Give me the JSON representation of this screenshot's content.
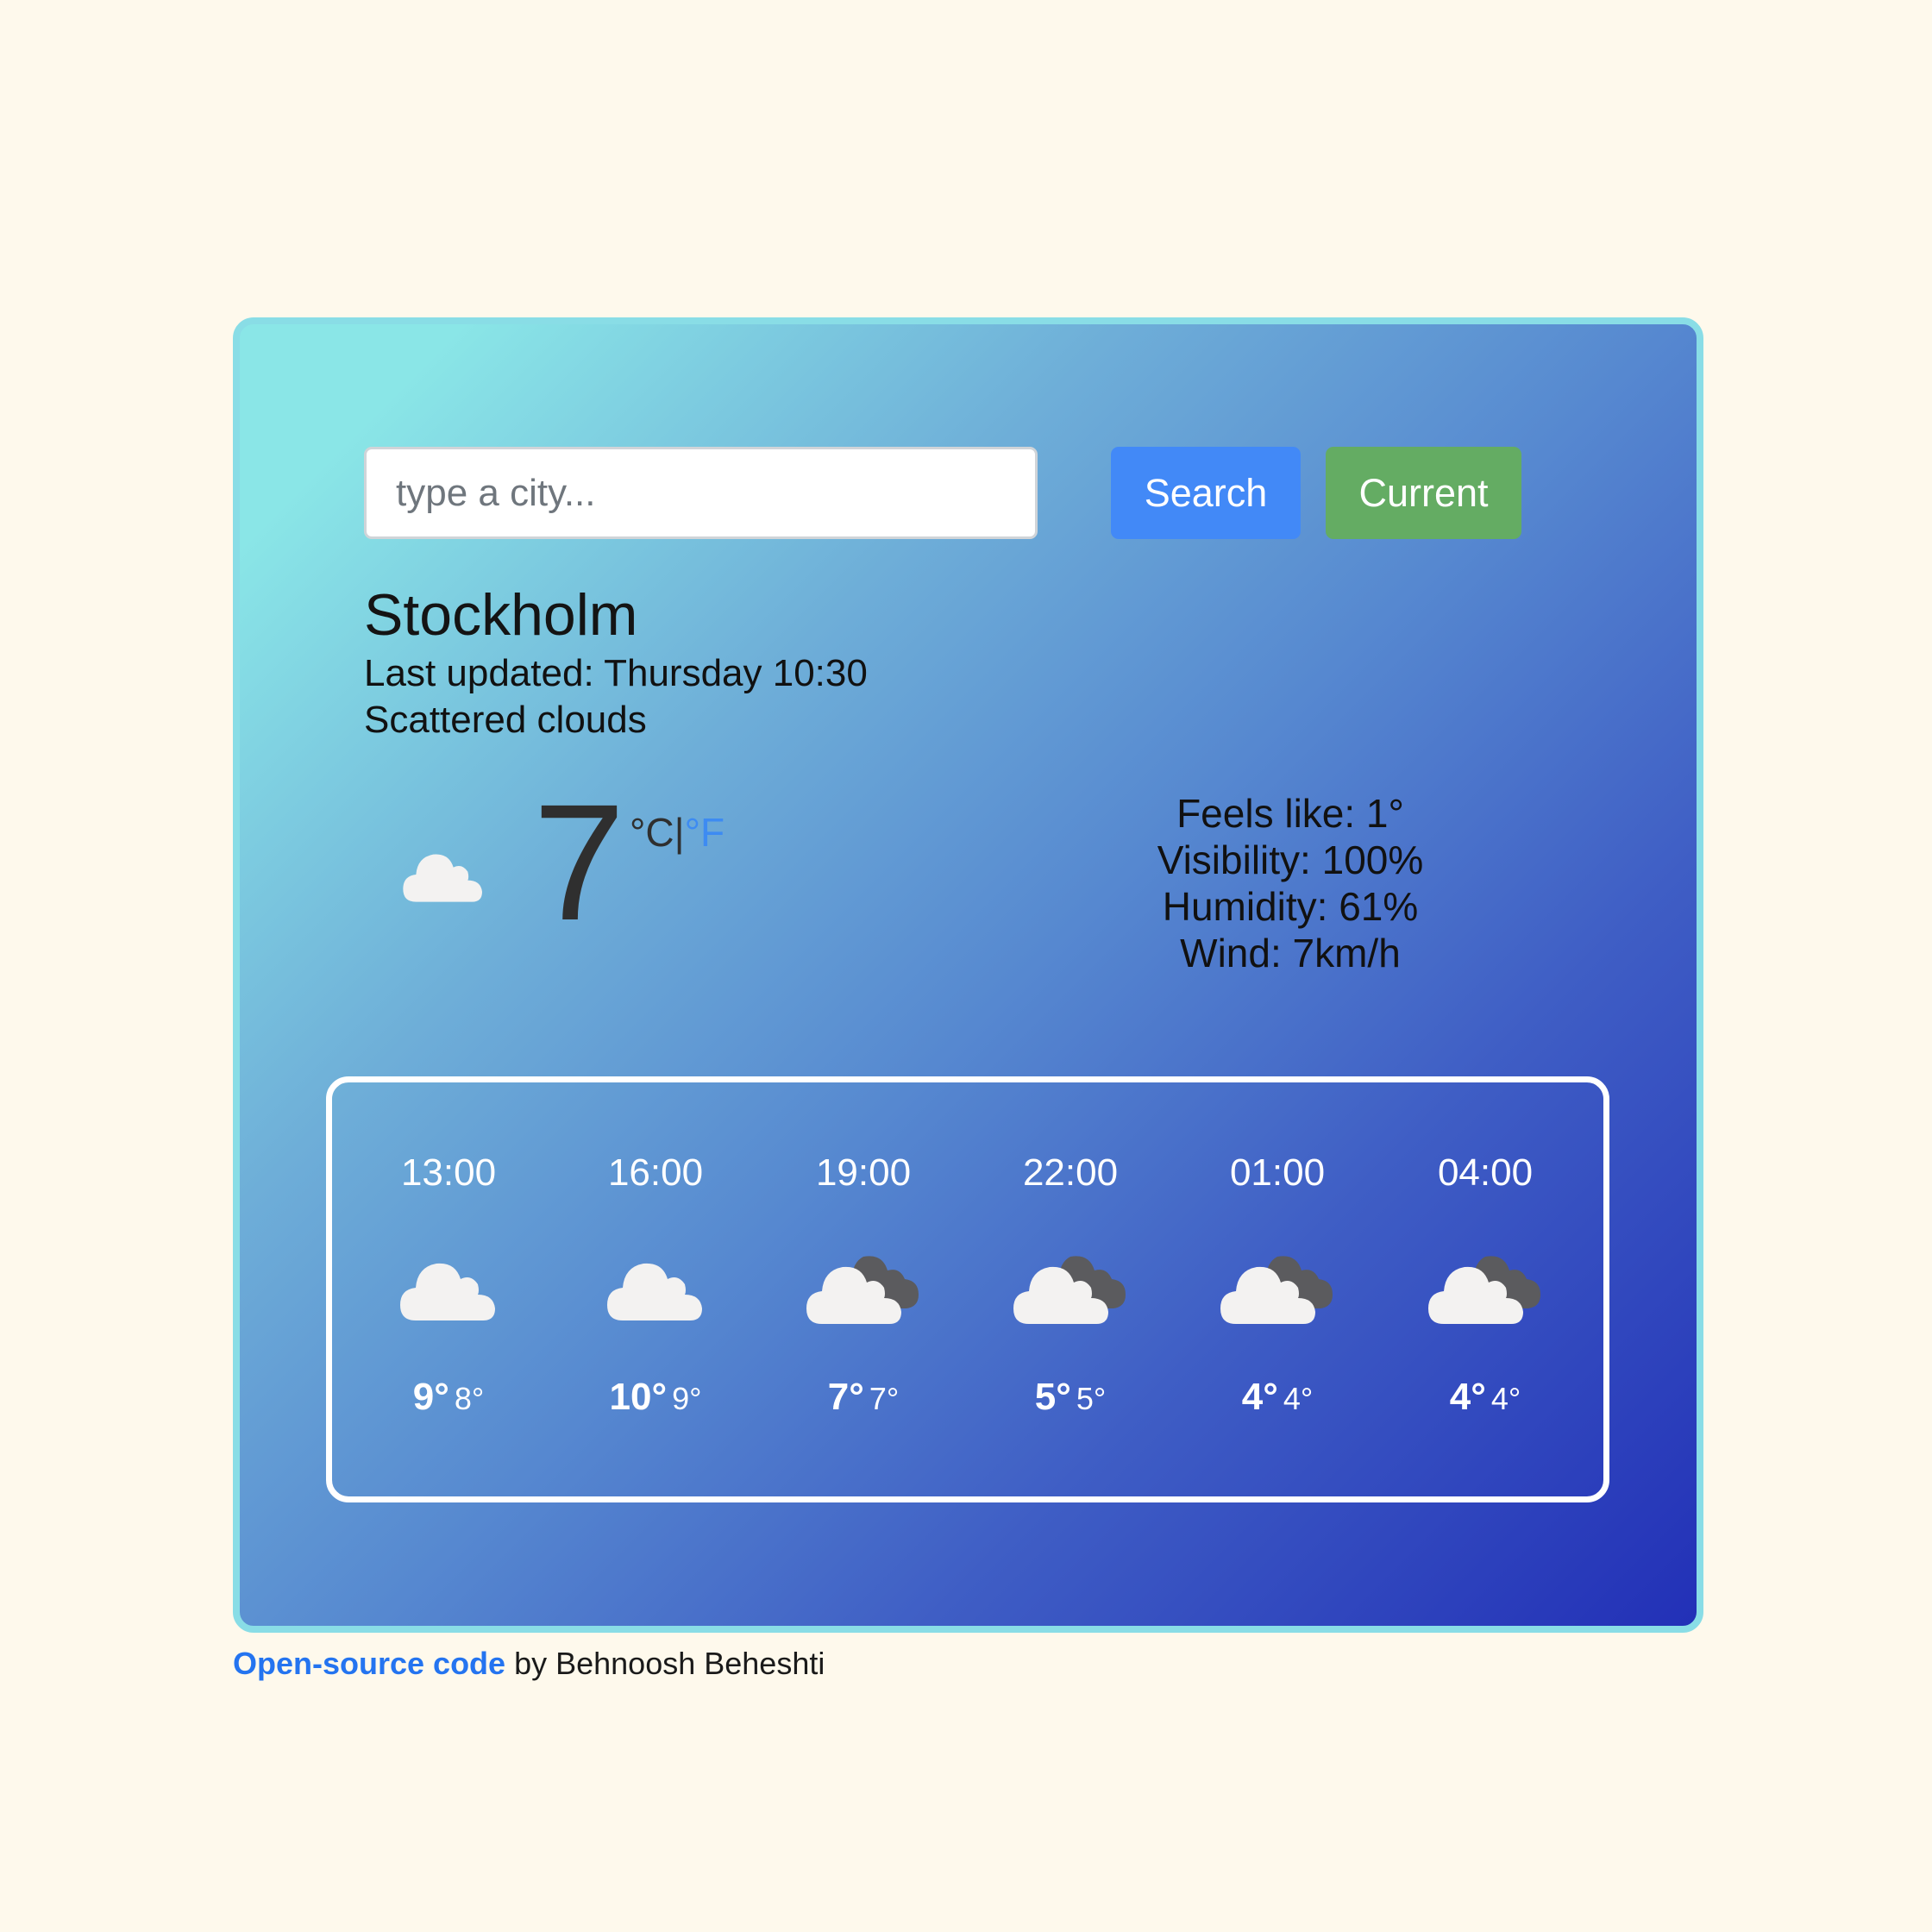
{
  "search": {
    "placeholder": "type a city...",
    "value": "",
    "search_label": "Search",
    "current_label": "Current"
  },
  "colors": {
    "search_button": "#4289f7",
    "current_button": "#64ac63",
    "fahrenheit_link": "#3d8bf2",
    "footer_link": "#2474f0",
    "page_background": "#fef9ec",
    "card_border": "#89dde6"
  },
  "current": {
    "city": "Stockholm",
    "last_updated": "Last updated: Thursday 10:30",
    "description": "Scattered clouds",
    "icon": "cloud-icon",
    "temperature": "7",
    "unit_celsius": "°C",
    "unit_separator": "|",
    "unit_fahrenheit": "°F",
    "details": {
      "feels_like": "Feels like: 1°",
      "visibility": "Visibility: 100%",
      "humidity": "Humidity: 61%",
      "wind": "Wind: 7km/h"
    }
  },
  "forecast": [
    {
      "time": "13:00",
      "icon": "cloud-icon",
      "max": "9°",
      "min": "8°"
    },
    {
      "time": "16:00",
      "icon": "cloud-icon",
      "max": "10°",
      "min": "9°"
    },
    {
      "time": "19:00",
      "icon": "broken-clouds-icon",
      "max": "7°",
      "min": "7°"
    },
    {
      "time": "22:00",
      "icon": "broken-clouds-icon",
      "max": "5°",
      "min": "5°"
    },
    {
      "time": "01:00",
      "icon": "broken-clouds-icon",
      "max": "4°",
      "min": "4°"
    },
    {
      "time": "04:00",
      "icon": "broken-clouds-icon",
      "max": "4°",
      "min": "4°"
    }
  ],
  "footer": {
    "link_text": "Open-source code",
    "suffix": " by Behnoosh Beheshti"
  }
}
